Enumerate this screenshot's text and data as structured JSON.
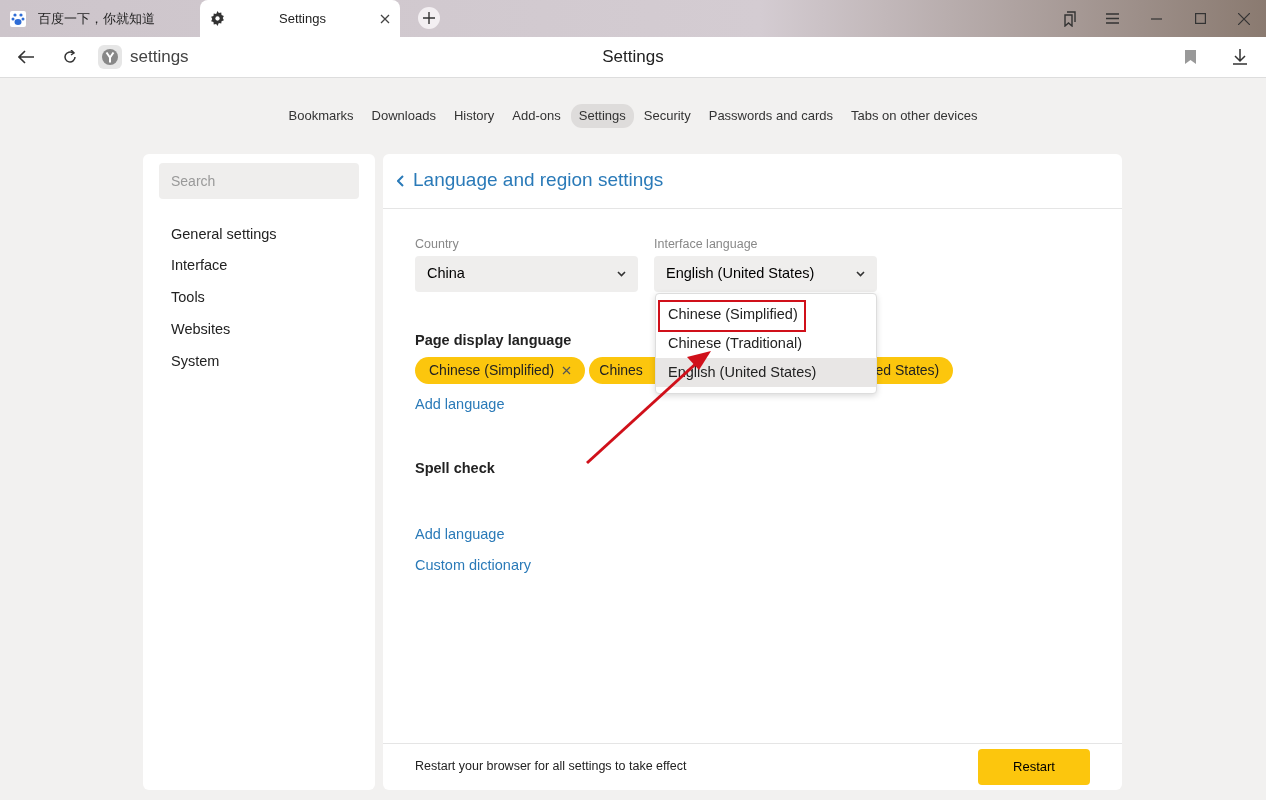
{
  "browser_tabs": [
    {
      "kind": "baidu",
      "title": "百度一下，你就知道",
      "selected": false,
      "closable": false
    },
    {
      "kind": "settings",
      "title": "Settings",
      "selected": true,
      "closable": true
    }
  ],
  "address": {
    "text": "settings",
    "page_title": "Settings"
  },
  "nav": [
    {
      "label": "Bookmarks",
      "selected": false
    },
    {
      "label": "Downloads",
      "selected": false
    },
    {
      "label": "History",
      "selected": false
    },
    {
      "label": "Add-ons",
      "selected": false
    },
    {
      "label": "Settings",
      "selected": true
    },
    {
      "label": "Security",
      "selected": false
    },
    {
      "label": "Passwords and cards",
      "selected": false
    },
    {
      "label": "Tabs on other devices",
      "selected": false
    }
  ],
  "sidebar": {
    "search_placeholder": "Search",
    "items": [
      "General settings",
      "Interface",
      "Tools",
      "Websites",
      "System"
    ]
  },
  "panel": {
    "title": "Language and region settings",
    "country": {
      "label": "Country",
      "value": "China"
    },
    "interface_language": {
      "label": "Interface language",
      "value": "English (United States)",
      "options": [
        {
          "label": "Chinese (Simplified)",
          "hovered": false,
          "highlighted": true
        },
        {
          "label": "Chinese (Traditional)",
          "hovered": false,
          "highlighted": false
        },
        {
          "label": "English (United States)",
          "hovered": true,
          "highlighted": false
        }
      ]
    },
    "page_display_language": {
      "title": "Page display language",
      "chips": [
        {
          "label": "Chinese (Simplified)",
          "removable": true
        },
        {
          "label": "Chines",
          "removable": false
        },
        {
          "label": "ed States)",
          "removable": false
        }
      ],
      "add_link": "Add language"
    },
    "spell_check": {
      "title": "Spell check",
      "links": [
        "Add language",
        "Custom dictionary"
      ]
    },
    "footer": {
      "text": "Restart your browser for all settings to take effect",
      "button": "Restart"
    }
  }
}
